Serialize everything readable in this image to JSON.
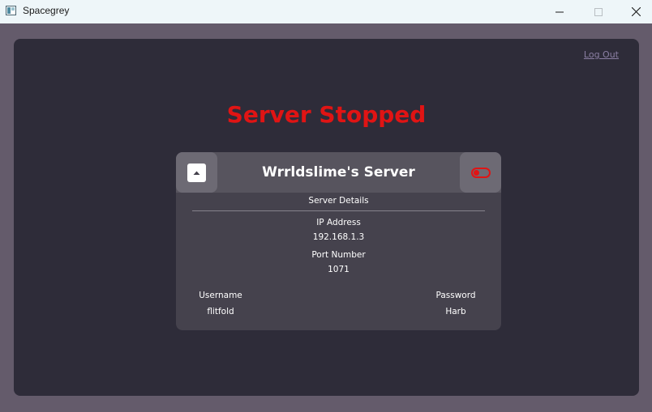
{
  "window": {
    "title": "Spacegrey",
    "controls": [
      "minimize-icon",
      "maximize-icon",
      "close-icon"
    ]
  },
  "header": {
    "logout_label": "Log Out"
  },
  "status": {
    "heading": "Server Stopped",
    "color": "#e01414"
  },
  "server_card": {
    "name": "Wrrldslime's Server",
    "section_title": "Server Details",
    "collapse_icon": "chevron-up-icon",
    "power_toggle": {
      "icon": "toggle-icon",
      "state": "off",
      "color": "#e01414"
    },
    "ip": {
      "label": "IP Address",
      "value": "192.168.1.3"
    },
    "port": {
      "label": "Port Number",
      "value": "1071"
    },
    "username": {
      "label": "Username",
      "value": "flitfold"
    },
    "password": {
      "label": "Password",
      "value": "Harb"
    }
  },
  "colors": {
    "outer_background": "#645b6b",
    "panel_background": "#2e2c39",
    "card_background": "#45424d",
    "card_header": "#57545e",
    "link_color": "#8b7fa3"
  }
}
